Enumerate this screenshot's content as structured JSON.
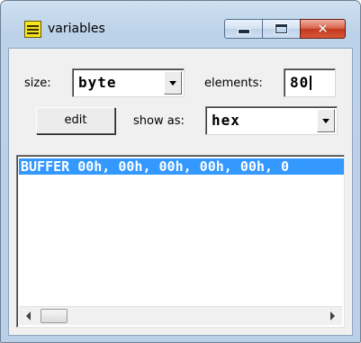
{
  "window": {
    "title": "variables",
    "icon": "variables-grid-icon"
  },
  "controls": {
    "size_label": "size:",
    "size_value": "byte",
    "elements_label": "elements:",
    "elements_value": "80",
    "edit_label": "edit",
    "show_as_label": "show as:",
    "show_as_value": "hex"
  },
  "list": {
    "items": [
      {
        "text": "BUFFER  00h, 00h, 00h, 00h, 00h, 0"
      }
    ],
    "selected_index": 0
  },
  "colors": {
    "selection": "#3399ff",
    "close_button": "#c4381e"
  }
}
